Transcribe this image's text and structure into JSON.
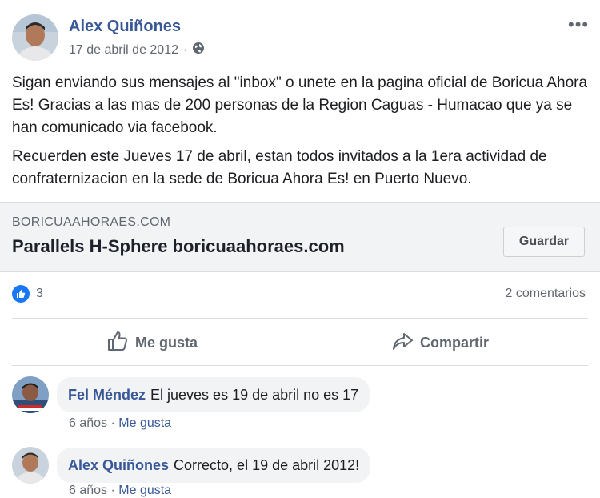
{
  "post": {
    "author": "Alex Quiñones",
    "date": "17 de abril de 2012",
    "separator": "·",
    "more_label": "•••",
    "paragraphs": [
      "Sigan enviando sus mensajes al \"inbox\" o unete en la pagina oficial de Boricua Ahora Es! Gracias a las mas de 200 personas de la Region Caguas - Humacao que ya se han comunicado via facebook.",
      "Recuerden este Jueves 17 de abril, estan todos invitados a la 1era actividad de confraternizacion en la sede de Boricua Ahora Es! en Puerto Nuevo."
    ]
  },
  "link_card": {
    "domain": "BORICUAAHORAES.COM",
    "title": "Parallels H-Sphere boricuaahoraes.com",
    "save_label": "Guardar"
  },
  "reactions": {
    "count": "3",
    "comments": "2 comentarios"
  },
  "actions": {
    "like": "Me gusta",
    "share": "Compartir"
  },
  "comments": [
    {
      "name": "Fel Méndez",
      "text": "El jueves es 19 de abril no es 17",
      "time": "6 años",
      "sep": " · ",
      "like": "Me gusta"
    },
    {
      "name": "Alex Quiñones",
      "text": "Correcto, el 19 de abril 2012!",
      "time": "6 años",
      "sep": " · ",
      "like": "Me gusta"
    }
  ],
  "colors": {
    "link_blue": "#385898",
    "like_blue": "#1877f2",
    "muted": "#606770",
    "card_bg": "#f2f3f5"
  },
  "icons": {
    "audience": "globe-icon",
    "reaction": "thumbs-up-icon",
    "like_action": "like-outline-icon",
    "share_action": "share-arrow-icon",
    "more": "more-options-icon"
  }
}
